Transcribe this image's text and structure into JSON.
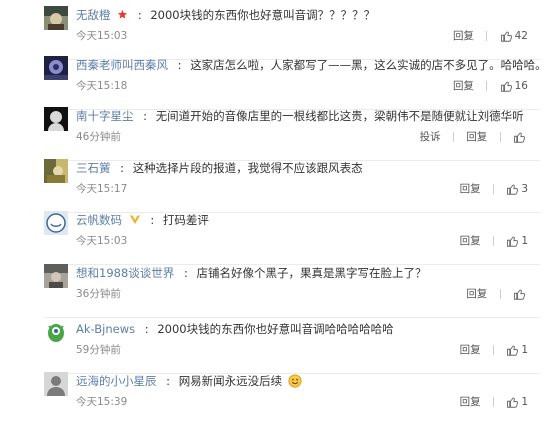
{
  "comments": [
    {
      "username": "无敌橙",
      "badge": "red-star",
      "text": "2000块钱的东西你也好意叫音调？？？？？",
      "time": "今天15:03",
      "reply_label": "回复",
      "likes": "42",
      "avatar_colors": [
        "#3d4a3f",
        "#8a8f77"
      ]
    },
    {
      "username": "西秦老师叫西秦风",
      "badge": "",
      "text": "这家店怎么啦，人家都写了——黑，这么实诚的店不多见了。哈哈哈。",
      "time": "今天15:18",
      "reply_label": "回复",
      "likes": "16",
      "avatar_colors": [
        "#1d2240",
        "#8c8bd0"
      ]
    },
    {
      "username": "南十字星尘",
      "badge": "",
      "text": "无间道开始的音像店里的一根线都比这贵，梁朝伟不是随便就让刘德华听",
      "time": "46分钟前",
      "report_label": "投诉",
      "reply_label": "回复",
      "likes": "",
      "avatar_colors": [
        "#111111",
        "#d9d9d9"
      ]
    },
    {
      "username": "三石黉",
      "badge": "",
      "text": "这种选择片段的报道，我觉得不应该跟风表态",
      "time": "今天15:17",
      "reply_label": "回复",
      "likes": "3",
      "avatar_colors": [
        "#6a6a3a",
        "#c7b770"
      ]
    },
    {
      "username": "云帆数码",
      "badge": "yellow-v",
      "text": "打码差评",
      "time": "今天15:03",
      "reply_label": "回复",
      "likes": "1",
      "avatar_colors": [
        "#dfe7ef",
        "#3b6a9c"
      ]
    },
    {
      "username": "想和1988谈谈世界",
      "badge": "",
      "text": "店铺名好像个黑子，果真是黑字写在脸上了？",
      "time": "36分钟前",
      "reply_label": "回复",
      "likes": "",
      "avatar_colors": [
        "#5c5f5a",
        "#a7a29a"
      ]
    },
    {
      "username": "Ak-Bjnews",
      "badge": "",
      "text": "2000块钱的东西你也好意叫音调哈哈哈哈哈哈",
      "time": "59分钟前",
      "reply_label": "回复",
      "likes": "1",
      "avatar_colors": [
        "#ffffff",
        "#4aa547"
      ]
    },
    {
      "username": "远海的小小星辰",
      "badge": "",
      "text": "网易新闻永远没后续",
      "time": "今天15:39",
      "reply_label": "回复",
      "likes": "1",
      "avatar_colors": [
        "#d7d7d7",
        "#7b7b7b"
      ]
    }
  ]
}
